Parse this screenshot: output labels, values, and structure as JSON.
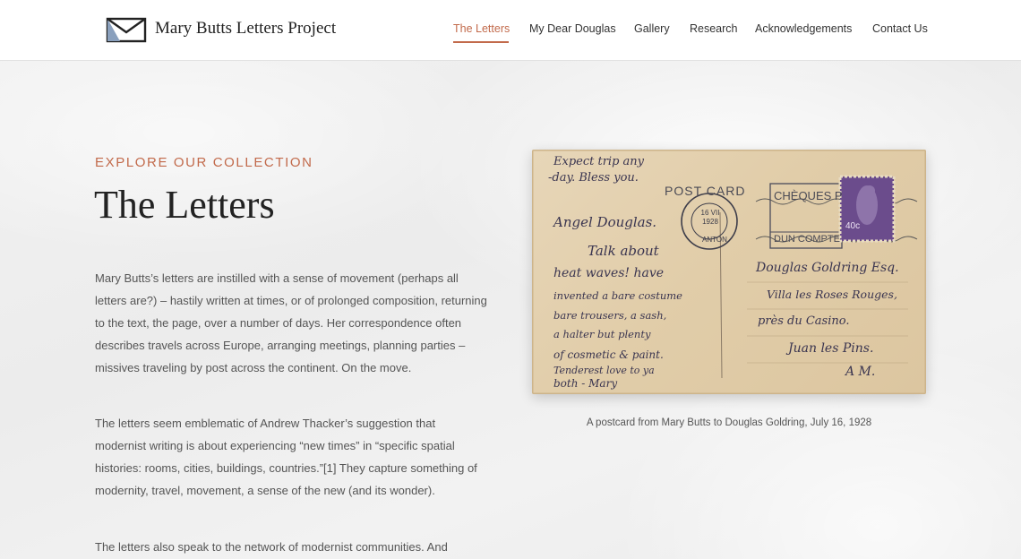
{
  "header": {
    "site_title": "Mary Butts Letters Project",
    "nav": [
      {
        "label": "The Letters",
        "active": true
      },
      {
        "label": "My Dear Douglas"
      },
      {
        "label": "Gallery"
      },
      {
        "label": "Research"
      },
      {
        "label": "Acknowledgements"
      },
      {
        "label": "Contact Us"
      }
    ]
  },
  "hero": {
    "eyebrow": "EXPLORE OUR COLLECTION",
    "title": "The Letters",
    "paragraphs": [
      "Mary Butts’s letters are instilled with a sense of movement (perhaps all letters are?) – hastily written at times, or of prolonged composition, returning to the text, the page, over a number of days. Her correspondence often describes travels across Europe, arranging meetings, planning parties – missives traveling by post across the continent. On the move.",
      "The letters seem emblematic of Andrew Thacker’s suggestion that modernist writing is about experiencing “new times” in “specific spatial histories: rooms, cities, buildings, countries.”[1] They capture something of modernity, travel, movement, a sense of the new (and its wonder).",
      "The letters also speak to the network of modernist communities. And"
    ]
  },
  "postcard": {
    "printed_title": "POST CARD",
    "postmark": {
      "date": "16 VII 1928",
      "place": "ANTON"
    },
    "stamp_value": "40c",
    "cancel_text": "CHÈQUES P",
    "cancel_text2": "DUN COMPTE",
    "hand_left": [
      "Expect trip any",
      "-day. Bless you.",
      "Angel Douglas.",
      "Talk about",
      "heat waves! have",
      "invented a bare costume",
      "bare trousers, a sash,",
      "a halter but plenty",
      "of cosmetic & paint.",
      "Tenderest love to ya",
      "both - Mary"
    ],
    "hand_right": [
      "Douglas Goldring Esq.",
      "Villa les Roses Rouges,",
      "près du Casino.",
      "Juan les Pins.",
      "A M."
    ],
    "caption": "A postcard from Mary Butts to Douglas Goldring, July 16, 1928"
  },
  "colors": {
    "accent": "#c26a4b",
    "title": "#222222",
    "body_text": "#555555",
    "background": "#f3f3f3",
    "header_bg": "#ffffff",
    "stamp": "#6b4c8c",
    "card": "#e3d0ae"
  },
  "icons": {
    "logo": "envelope-logo-icon"
  }
}
